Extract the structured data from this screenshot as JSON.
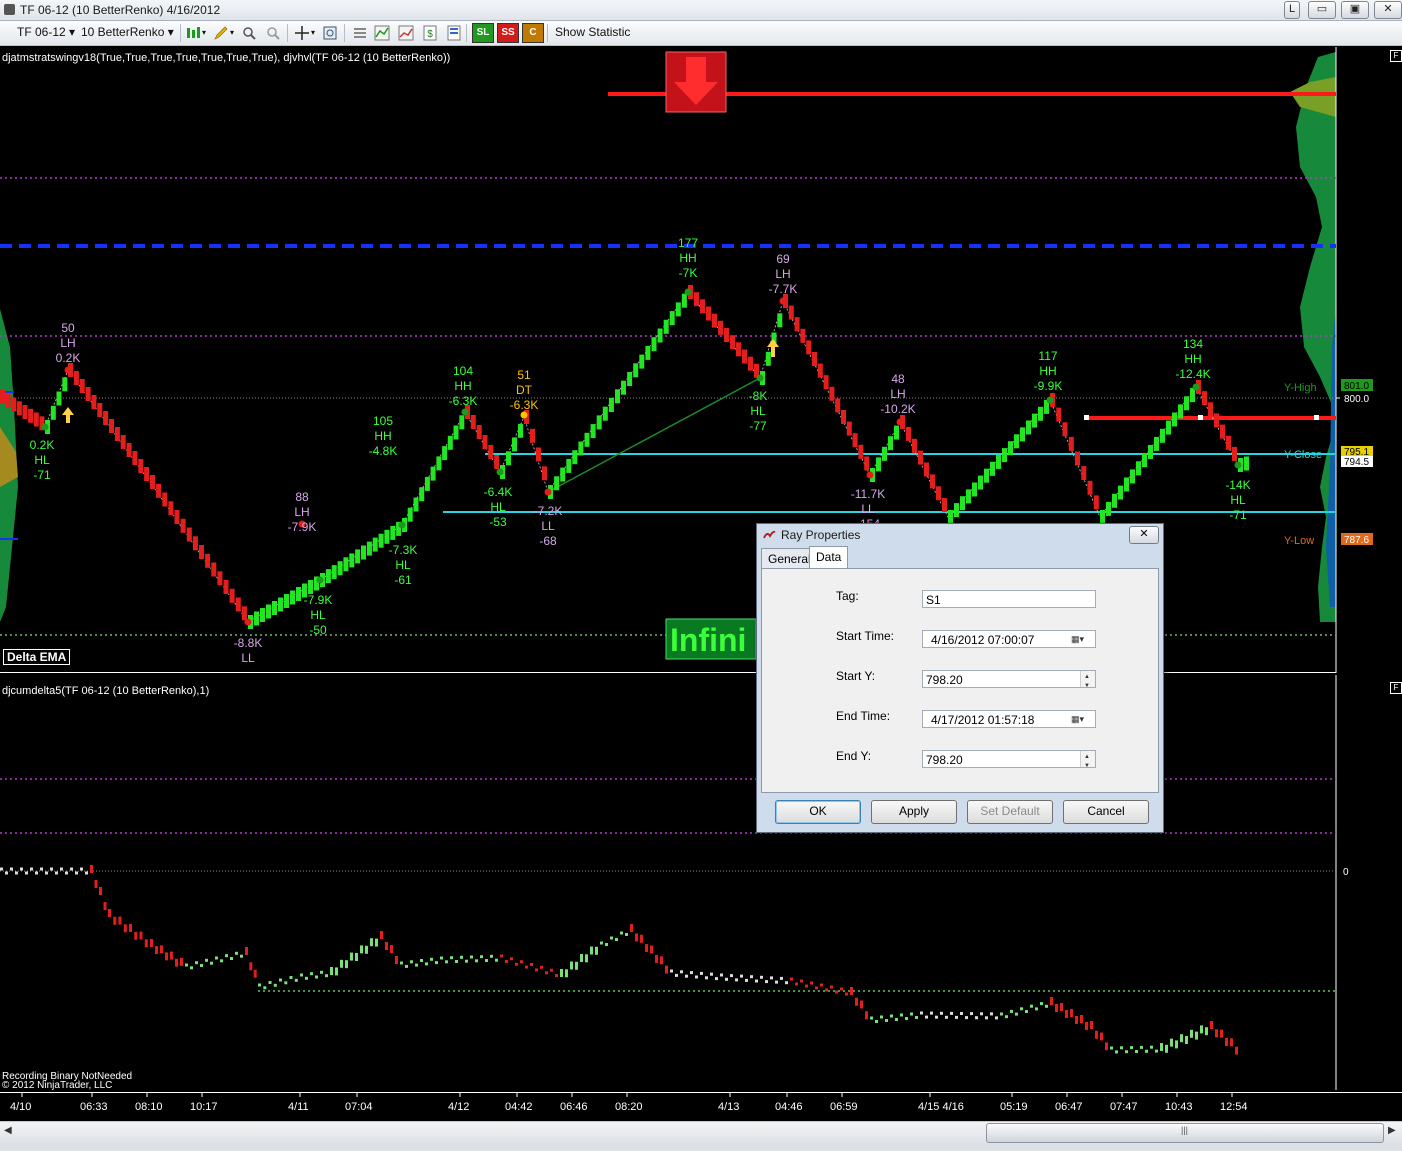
{
  "window": {
    "title": "TF 06-12 (10 BetterRenko)  4/16/2012",
    "buttons": {
      "l": "L",
      "minimize": "▭",
      "maximize": "▣",
      "close": "✕"
    }
  },
  "toolbar": {
    "instrument": "TF 06-12",
    "interval": "10 BetterRenko",
    "sl": "SL",
    "ss": "SS",
    "c": "C",
    "show_statistic": "Show Statistic",
    "colors": {
      "sl": "#1f9a1f",
      "ss": "#d21c1c",
      "c": "#c07a00"
    }
  },
  "main_panel": {
    "indicator_label": "djatmstratswingv18(True,True,True,True,True,True,True), djvhvl(TF 06-12 (10 BetterRenko))",
    "delta_ema": "Delta EMA",
    "infinity": "Infini",
    "price_labels": {
      "p801": "801.0",
      "p800": "800.0",
      "p795": "795.1",
      "p794": "794.5",
      "p787": "787.6"
    },
    "level_labels": {
      "y_high": "Y-High",
      "y_close": "Y-Close",
      "y_low": "Y-Low"
    },
    "swing_labels": [
      {
        "lines": [
          "50",
          "LH",
          "0.2K"
        ],
        "color": "#d6a8e8"
      },
      {
        "lines": [
          "0.2K",
          "HL",
          "-71"
        ],
        "color": "#3cff3c"
      },
      {
        "lines": [
          "-8.8K",
          "LL"
        ],
        "color": "#d6a8e8"
      },
      {
        "lines": [
          "88",
          "LH",
          "-7.9K"
        ],
        "color": "#d6a8e8"
      },
      {
        "lines": [
          "-7.9K",
          "HL",
          "-50"
        ],
        "color": "#3cff3c"
      },
      {
        "lines": [
          "105",
          "HH",
          "-4.8K"
        ],
        "color": "#3cff3c"
      },
      {
        "lines": [
          "-7.3K",
          "HL",
          "-61"
        ],
        "color": "#3cff3c"
      },
      {
        "lines": [
          "104",
          "HH",
          "-6.3K"
        ],
        "color": "#3cff3c"
      },
      {
        "lines": [
          "51",
          "DT",
          "-6.3K"
        ],
        "color": "#ffc400"
      },
      {
        "lines": [
          "-6.4K",
          "HL",
          "-53"
        ],
        "color": "#3cff3c"
      },
      {
        "lines": [
          "-7.2K",
          "LL",
          "-68"
        ],
        "color": "#d6a8e8"
      },
      {
        "lines": [
          "177",
          "HH",
          "-7K"
        ],
        "color": "#3cff3c"
      },
      {
        "lines": [
          "69",
          "LH",
          "-7.7K"
        ],
        "color": "#d6a8e8"
      },
      {
        "lines": [
          "-8K",
          "HL",
          "-77"
        ],
        "color": "#3cff3c"
      },
      {
        "lines": [
          "48",
          "LH",
          "-10.2K"
        ],
        "color": "#d6a8e8"
      },
      {
        "lines": [
          "-11.7K",
          "LL",
          "-154"
        ],
        "color": "#d6a8e8"
      },
      {
        "lines": [
          "117",
          "HH",
          "-9.9K"
        ],
        "color": "#3cff3c"
      },
      {
        "lines": [
          "134",
          "HH",
          "-12.4K"
        ],
        "color": "#3cff3c"
      },
      {
        "lines": [
          "-14K",
          "HL",
          "-71"
        ],
        "color": "#3cff3c"
      }
    ]
  },
  "lower_panel": {
    "indicator_label": "djcumdelta5(TF 06-12 (10 BetterRenko),1)",
    "zero_label": "0",
    "notes": [
      "Recording Binary NotNeeded",
      "© 2012 NinjaTrader, LLC"
    ]
  },
  "time_axis": [
    "4/10",
    "06:33",
    "08:10",
    "10:17",
    "4/11",
    "07:04",
    "4/12",
    "04:42",
    "06:46",
    "08:20",
    "4/13",
    "04:46",
    "06:59",
    "4/15 4/16",
    "05:19",
    "06:47",
    "07:47",
    "10:43",
    "12:54"
  ],
  "dialog": {
    "title": "Ray Properties",
    "tabs": [
      "General",
      "Data"
    ],
    "active_tab": "Data",
    "fields": {
      "tag_label": "Tag:",
      "tag_value": "S1",
      "start_time_label": "Start Time:",
      "start_time_value": "4/16/2012 07:00:07",
      "start_y_label": "Start Y:",
      "start_y_value": "798.20",
      "end_time_label": "End Time:",
      "end_time_value": "4/17/2012 01:57:18",
      "end_y_label": "End Y:",
      "end_y_value": "798.20"
    },
    "buttons": {
      "ok": "OK",
      "apply": "Apply",
      "set_default": "Set Default",
      "cancel": "Cancel"
    }
  }
}
